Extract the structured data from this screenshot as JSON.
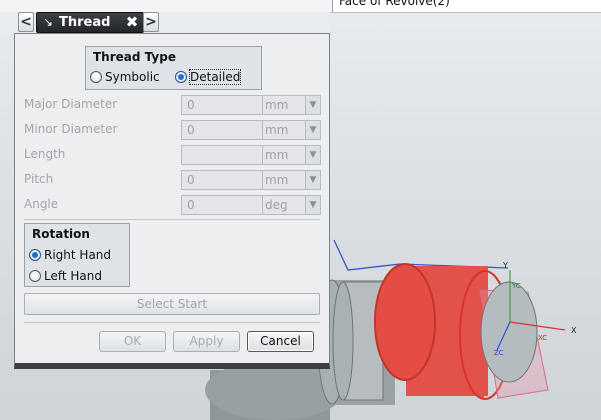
{
  "graphics": {
    "face_label": "Face of Revolve(2)",
    "axis_y": "Y",
    "axis_yc": "YC",
    "axis_x": "X",
    "axis_xc": "XC",
    "axis_zc": "ZC"
  },
  "dialog": {
    "nav_back": "<",
    "nav_forward": ">",
    "title": "Thread",
    "thread_type": {
      "title": "Thread Type",
      "options": [
        "Symbolic",
        "Detailed"
      ],
      "selected": "Detailed"
    },
    "fields": [
      {
        "label": "Major Diameter",
        "value": "0",
        "unit": "mm"
      },
      {
        "label": "Minor Diameter",
        "value": "0",
        "unit": "mm"
      },
      {
        "label": "Length",
        "value": "",
        "unit": "mm"
      },
      {
        "label": "Pitch",
        "value": "0",
        "unit": "mm"
      },
      {
        "label": "Angle",
        "value": "0",
        "unit": "deg"
      }
    ],
    "rotation": {
      "title": "Rotation",
      "options": [
        "Right Hand",
        "Left Hand"
      ],
      "selected": "Right Hand"
    },
    "select_start_label": "Select Start",
    "buttons": {
      "ok": "OK",
      "apply": "Apply",
      "cancel": "Cancel"
    }
  },
  "colors": {
    "cylinder_red": "#e8534a",
    "body_gray": "#9aa2a6",
    "title_bar": "#2b2e33",
    "radio_selected": "#1f6fd0"
  }
}
